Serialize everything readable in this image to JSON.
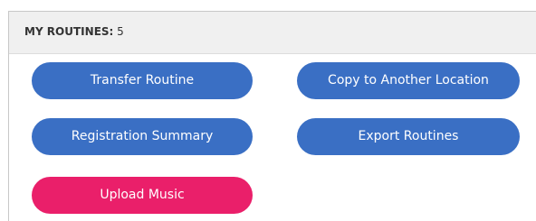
{
  "header": {
    "label": "MY ROUTINES:",
    "count": "5"
  },
  "buttons": {
    "transfer": "Transfer Routine",
    "copy": "Copy to Another Location",
    "registration": "Registration Summary",
    "export": "Export Routines",
    "upload": "Upload Music"
  },
  "colors": {
    "primary_button": "#3a6fc4",
    "upload_button": "#ea1f6a",
    "header_background": "#f0f0f0"
  }
}
